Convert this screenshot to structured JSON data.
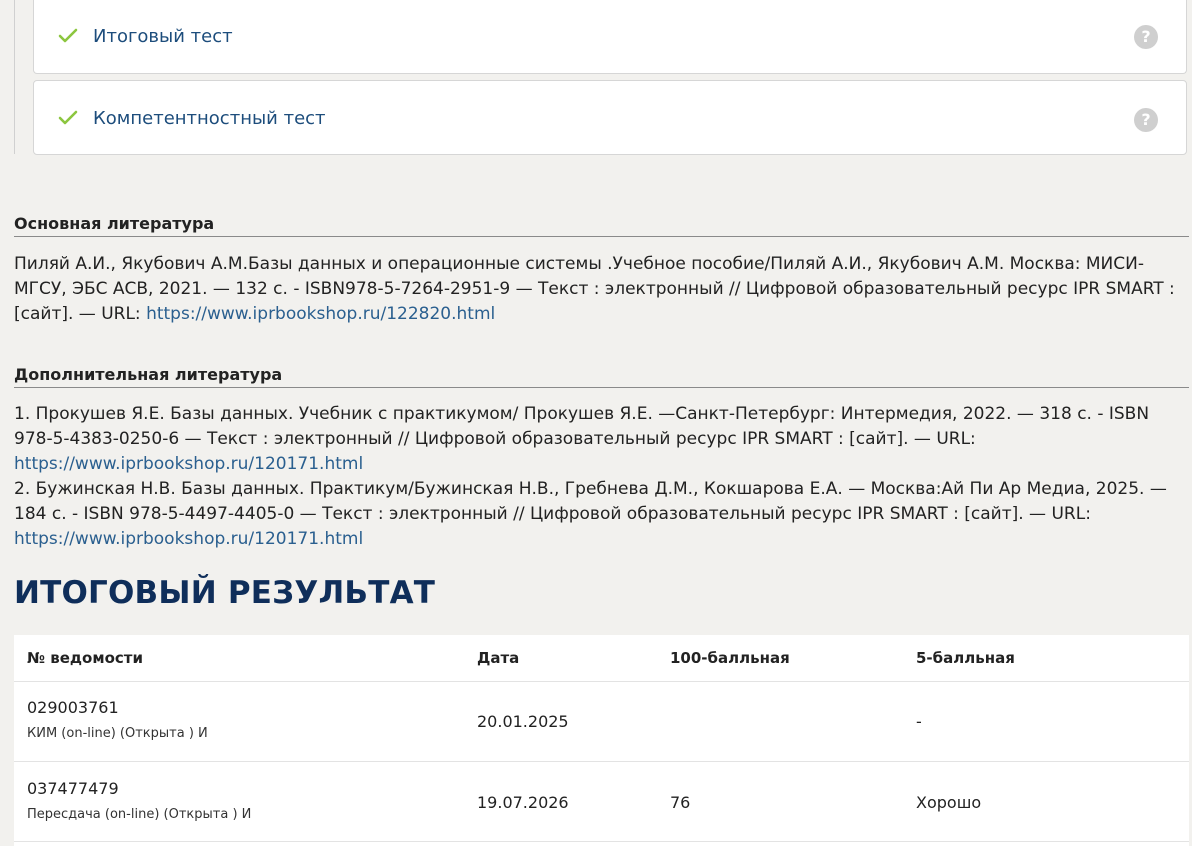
{
  "tests": [
    {
      "title": "Итоговый тест",
      "help": "?"
    },
    {
      "title": "Компетентностный тест",
      "help": "?"
    }
  ],
  "main_lit": {
    "heading": "Основная литература",
    "text": "Пиляй А.И., Якубович А.М.Базы данных и операционные системы .Учебное пособие/Пиляй А.И., Якубович А.М. Москва: МИСИ-МГСУ, ЭБС АСВ, 2021. — 132 с. - ISBN978-5-7264-2951-9 — Текст : электронный // Цифровой образовательный ресурс IPR SMART : [сайт]. — URL: ",
    "link": "https://www.iprbookshop.ru/122820.html"
  },
  "extra_lit": {
    "heading": "Дополнительная литература",
    "item1_text": "1. Прокушев Я.Е. Базы данных. Учебник с практикумом/ Прокушев Я.Е. —Санкт-Петербург: Интермедия, 2022. — 318 с. - ISBN 978-5-4383-0250-6 — Текст : электронный // Цифровой образовательный ресурс IPR SMART : [сайт]. — URL: ",
    "item1_link": "https://www.iprbookshop.ru/120171.html",
    "item2_text": "2. Бужинская Н.В. Базы данных. Практикум/Бужинская Н.В., Гребнева Д.М., Кокшарова Е.А. — Москва:Ай Пи Ар Медиа, 2025. — 184 с. - ISBN 978-5-4497-4405-0 — Текст : электронный // Цифровой образовательный ресурс IPR SMART : [сайт]. — URL: ",
    "item2_link": "https://www.iprbookshop.ru/120171.html"
  },
  "result": {
    "title": "ИТОГОВЫЙ РЕЗУЛЬТАТ",
    "headers": {
      "num": "№ ведомости",
      "date": "Дата",
      "score100": "100-балльная",
      "score5": "5-балльная"
    },
    "rows": [
      {
        "num": "029003761",
        "type": "КИМ (on-line) (Открыта ) И",
        "date": "20.01.2025",
        "score100": "",
        "score5": "-"
      },
      {
        "num": "037477479",
        "type": "Пересдача (on-line) (Открыта ) И",
        "date": "19.07.2026",
        "score100": "76",
        "score5": "Хорошо"
      }
    ]
  },
  "colors": {
    "accent": "#1d4d7c",
    "check": "#8cc63f",
    "title_dark": "#0f2e5a",
    "background": "#f2f1ee"
  }
}
